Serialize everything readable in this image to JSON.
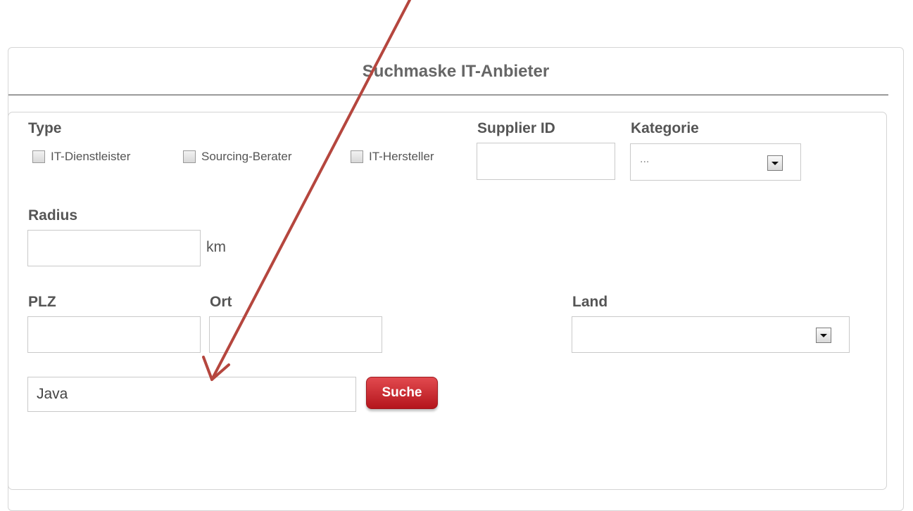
{
  "panel": {
    "title": "Suchmaske IT-Anbieter"
  },
  "form": {
    "type_label": "Type",
    "type_options": [
      "IT-Dienstleister",
      "Sourcing-Berater",
      "IT-Hersteller"
    ],
    "supplier_id_label": "Supplier ID",
    "supplier_id_value": "",
    "kategorie_label": "Kategorie",
    "kategorie_value": "...",
    "radius_label": "Radius",
    "radius_value": "",
    "radius_unit": "km",
    "plz_label": "PLZ",
    "plz_value": "",
    "ort_label": "Ort",
    "ort_value": "",
    "land_label": "Land",
    "land_value": "",
    "keyword_value": "Java",
    "search_button": "Suche"
  },
  "annotation": {
    "arrow_color": "#b5463e"
  },
  "colors": {
    "accent": "#c51d24"
  }
}
